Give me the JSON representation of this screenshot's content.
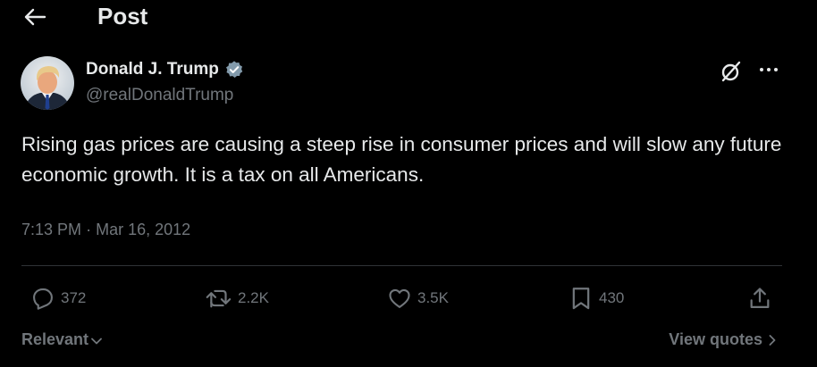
{
  "header": {
    "back_icon": "arrow-left-icon",
    "title": "Post"
  },
  "post": {
    "author": {
      "name": "Donald J. Trump",
      "handle": "@realDonaldTrump",
      "verified_icon": "verified-badge-icon",
      "verified_color": "#829aab"
    },
    "grok_icon": "grok-icon",
    "more_icon": "more-horizontal-icon",
    "text": "Rising gas prices are causing a steep rise in consumer prices and will slow any future economic growth. It is a tax on all Americans.",
    "time": "7:13 PM",
    "separator": "·",
    "date": "Mar 16, 2012"
  },
  "actions": {
    "reply": {
      "icon": "reply-icon",
      "count": "372"
    },
    "repost": {
      "icon": "repost-icon",
      "count": "2.2K"
    },
    "like": {
      "icon": "heart-icon",
      "count": "3.5K"
    },
    "bookmark": {
      "icon": "bookmark-icon",
      "count": "430"
    },
    "share": {
      "icon": "share-icon"
    }
  },
  "footer": {
    "sort_label": "Relevant",
    "sort_icon": "chevron-down-icon",
    "quotes_label": "View quotes",
    "quotes_icon": "chevron-right-icon"
  },
  "colors": {
    "background": "#000000",
    "text_primary": "#e7e9ea",
    "text_secondary": "#71767b",
    "divider": "#2f3336"
  }
}
